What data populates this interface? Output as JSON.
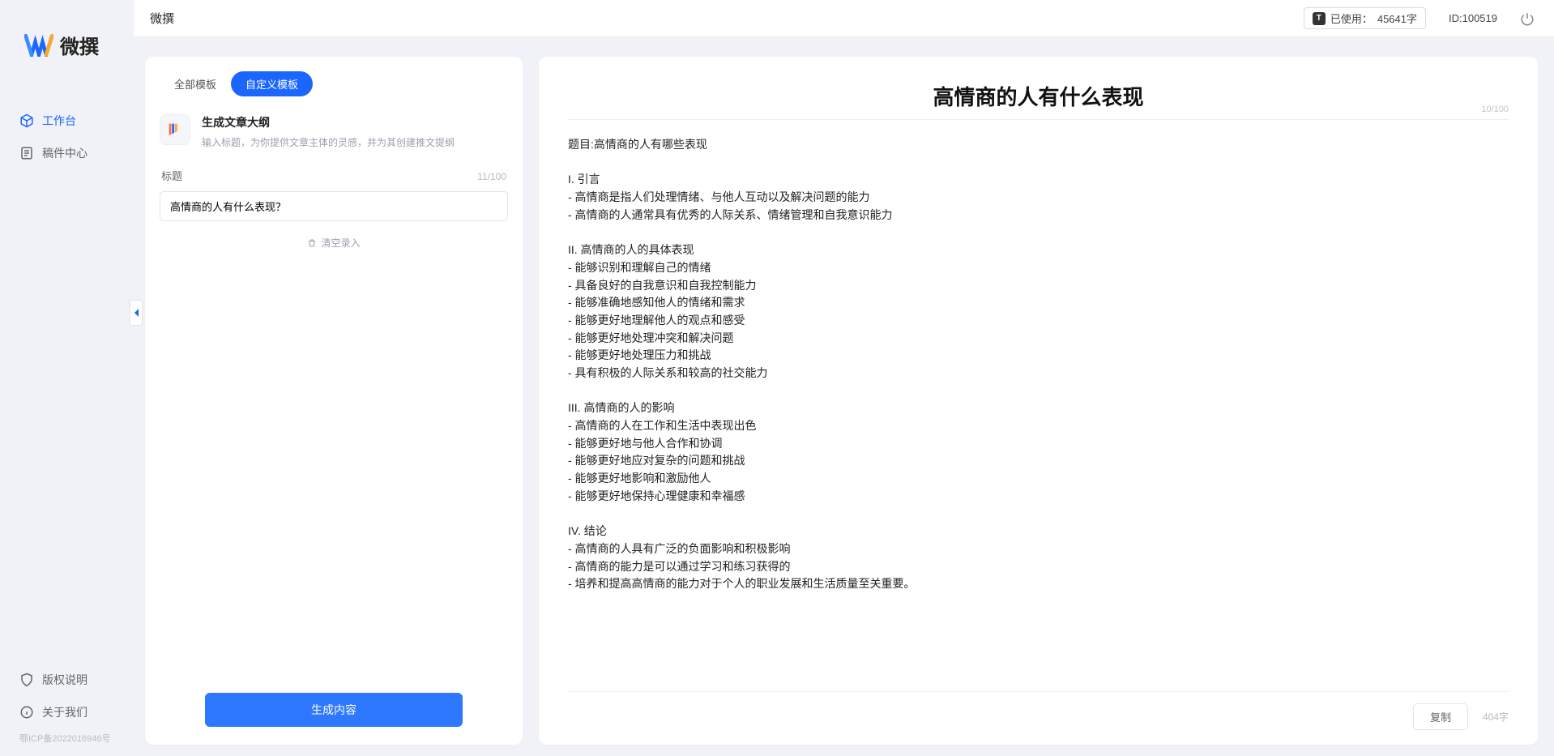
{
  "header": {
    "app_title": "微撰",
    "usage_label": "已使用：",
    "usage_value": "45641字",
    "user_id_label": "ID:100519"
  },
  "sidebar": {
    "logo_text": "微撰",
    "items": [
      {
        "label": "工作台",
        "icon": "cube-icon",
        "active": true
      },
      {
        "label": "稿件中心",
        "icon": "document-icon",
        "active": false
      }
    ],
    "bottom_items": [
      {
        "label": "版权说明",
        "icon": "shield-icon"
      },
      {
        "label": "关于我们",
        "icon": "info-icon"
      }
    ],
    "icp": "鄂ICP备2022016946号"
  },
  "left": {
    "tabs": [
      {
        "label": "全部模板",
        "active": false
      },
      {
        "label": "自定义模板",
        "active": true
      }
    ],
    "template": {
      "title": "生成文章大纲",
      "desc": "输入标题，为你提供文章主体的灵感，并为其创建推文提纲"
    },
    "field": {
      "label": "标题",
      "char_count": "11/100",
      "value": "高情商的人有什么表现？"
    },
    "clear_label": "清空录入",
    "generate_label": "生成内容"
  },
  "right": {
    "title": "高情商的人有什么表现",
    "title_count": "10/100",
    "body": "题目:高情商的人有哪些表现\n\nI. 引言\n- 高情商是指人们处理情绪、与他人互动以及解决问题的能力\n- 高情商的人通常具有优秀的人际关系、情绪管理和自我意识能力\n\nII. 高情商的人的具体表现\n- 能够识别和理解自己的情绪\n- 具备良好的自我意识和自我控制能力\n- 能够准确地感知他人的情绪和需求\n- 能够更好地理解他人的观点和感受\n- 能够更好地处理冲突和解决问题\n- 能够更好地处理压力和挑战\n- 具有积极的人际关系和较高的社交能力\n\nIII. 高情商的人的影响\n- 高情商的人在工作和生活中表现出色\n- 能够更好地与他人合作和协调\n- 能够更好地应对复杂的问题和挑战\n- 能够更好地影响和激励他人\n- 能够更好地保持心理健康和幸福感\n\nIV. 结论\n- 高情商的人具有广泛的负面影响和积极影响\n- 高情商的能力是可以通过学习和练习获得的\n- 培养和提高高情商的能力对于个人的职业发展和生活质量至关重要。",
    "copy_label": "复制",
    "word_count": "404字"
  }
}
